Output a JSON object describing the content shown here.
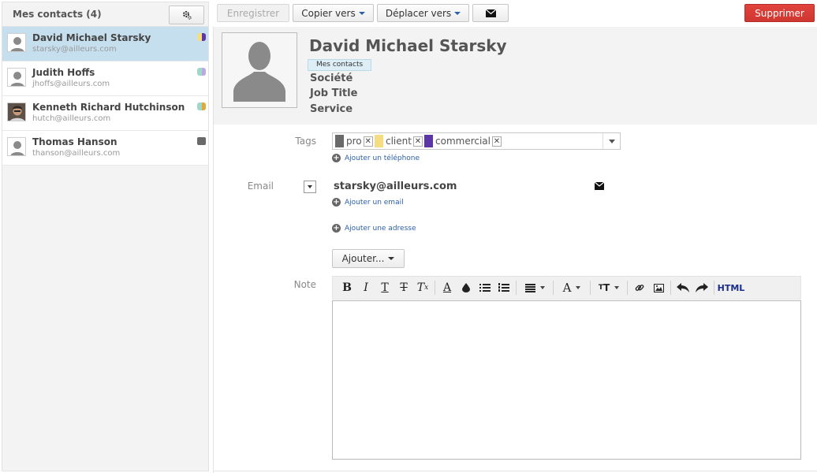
{
  "sidebar": {
    "title": "Mes contacts (4)",
    "gear_icon": "gear-icon",
    "contacts": [
      {
        "name": "David Michael Starsky",
        "email": "starsky@ailleurs.com",
        "selected": true,
        "tag_colors": [
          "#f4dd82",
          "#5b36a6"
        ]
      },
      {
        "name": "Judith Hoffs",
        "email": "jhoffs@ailleurs.com",
        "selected": false,
        "tag_colors": [
          "#9ed8c9",
          "#bca8e2"
        ]
      },
      {
        "name": "Kenneth Richard Hutchinson",
        "email": "hutch@ailleurs.com",
        "selected": false,
        "tag_colors": [
          "#9ed8c9",
          "#e1a93c"
        ]
      },
      {
        "name": "Thomas Hanson",
        "email": "thanson@ailleurs.com",
        "selected": false,
        "tag_colors": [
          "#6a6a6a"
        ]
      }
    ]
  },
  "toolbar": {
    "save_label": "Enregistrer",
    "copy_label": "Copier vers",
    "move_label": "Déplacer vers",
    "mail_icon": "envelope-icon",
    "delete_label": "Supprimer"
  },
  "card": {
    "name": "David Michael Starsky",
    "group": "Mes contacts",
    "company": "Société",
    "job_title": "Job Title",
    "department": "Service"
  },
  "form": {
    "tags_label": "Tags",
    "tags": [
      {
        "label": "pro",
        "color": "#6a6a6a"
      },
      {
        "label": "client",
        "color": "#f4dd82"
      },
      {
        "label": "commercial",
        "color": "#5b36a6"
      }
    ],
    "add_phone": "Ajouter un téléphone",
    "email_label": "Email",
    "email_value": "starsky@ailleurs.com",
    "add_email": "Ajouter un email",
    "add_address": "Ajouter une adresse",
    "add_more": "Ajouter...",
    "note_label": "Note",
    "html_label": "HTML"
  },
  "colors": {
    "selected_row": "#c6dfee",
    "delete_button": "#d63c35",
    "link": "#2b5fa8"
  }
}
